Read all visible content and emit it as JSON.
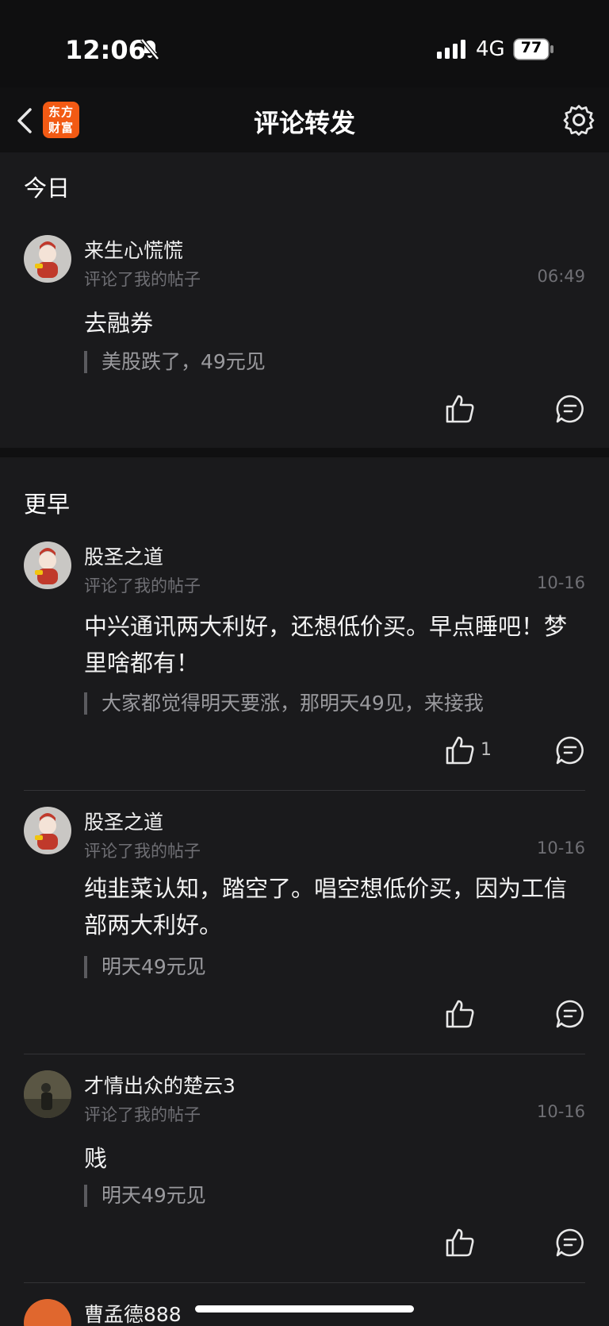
{
  "status": {
    "time": "12:06",
    "network": "4G",
    "battery": "77"
  },
  "nav": {
    "title": "评论转发",
    "logo_line1": "东方",
    "logo_line2": "财富"
  },
  "sections": {
    "today": "今日",
    "earlier": "更早"
  },
  "items": [
    {
      "user": "来生心慌慌",
      "action": "评论了我的帖子",
      "time": "06:49",
      "text": "去融券",
      "quote": "美股跌了，49元见",
      "likes": ""
    },
    {
      "user": "股圣之道",
      "action": "评论了我的帖子",
      "time": "10-16",
      "text": "中兴通讯两大利好，还想低价买。早点睡吧！梦里啥都有！",
      "quote": "大家都觉得明天要涨，那明天49见，来接我",
      "likes": "1"
    },
    {
      "user": "股圣之道",
      "action": "评论了我的帖子",
      "time": "10-16",
      "text": "纯韭菜认知，踏空了。唱空想低价买，因为工信部两大利好。",
      "quote": "明天49元见",
      "likes": ""
    },
    {
      "user": "才情出众的楚云3",
      "action": "评论了我的帖子",
      "time": "10-16",
      "text": "贱",
      "quote": "明天49元见",
      "likes": ""
    },
    {
      "user": "曹孟德888"
    }
  ]
}
